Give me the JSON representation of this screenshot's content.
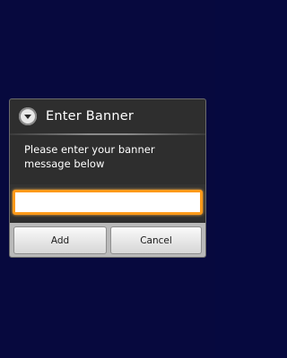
{
  "dialog": {
    "title": "Enter Banner",
    "icon": "alert-circle-icon",
    "message": "Please enter your banner message below",
    "input": {
      "value": "",
      "placeholder": ""
    },
    "buttons": {
      "add_label": "Add",
      "cancel_label": "Cancel"
    }
  },
  "colors": {
    "background": "#07093e",
    "dialog_bg": "#2e2e2e",
    "focus_border": "#ff9a1a"
  }
}
